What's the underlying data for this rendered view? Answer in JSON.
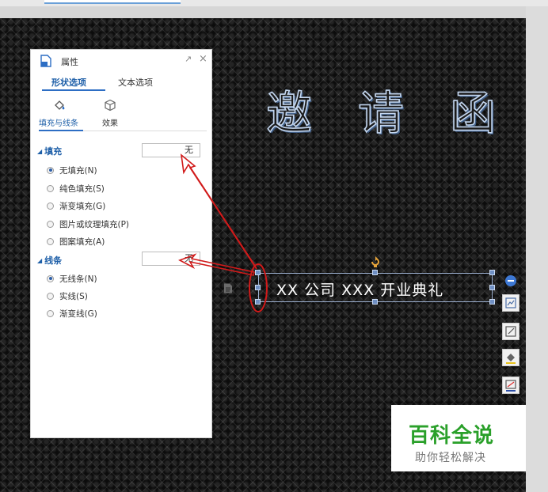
{
  "panel": {
    "title": "属性",
    "pin_icon": "pin-icon",
    "close_icon": "close-icon",
    "tabs": [
      {
        "label": "形状选项",
        "active": true
      },
      {
        "label": "文本选项",
        "active": false
      }
    ],
    "subtabs": [
      {
        "label": "填充与线条",
        "icon": "paint-bucket-icon",
        "active": true
      },
      {
        "label": "效果",
        "icon": "cube-icon",
        "active": false
      }
    ],
    "fill": {
      "heading": "填充",
      "value": "无",
      "options": [
        {
          "label": "无填充(N)",
          "selected": true
        },
        {
          "label": "纯色填充(S)",
          "selected": false
        },
        {
          "label": "渐变填充(G)",
          "selected": false
        },
        {
          "label": "图片或纹理填充(P)",
          "selected": false
        },
        {
          "label": "图案填充(A)",
          "selected": false
        }
      ]
    },
    "line": {
      "heading": "线条",
      "value": "无",
      "options": [
        {
          "label": "无线条(N)",
          "selected": true
        },
        {
          "label": "实线(S)",
          "selected": false
        },
        {
          "label": "渐变线(G)",
          "selected": false
        }
      ]
    }
  },
  "slide": {
    "title_chars": [
      "邀",
      "请",
      "函"
    ],
    "textbox_text": "XX 公司 XXX 开业典礼"
  },
  "toolbar": {
    "buttons": [
      "collapse-icon",
      "layout-icon",
      "crop-icon",
      "fill-icon",
      "outline-icon"
    ]
  },
  "watermark": {
    "title": "百科全说",
    "subtitle": "助你轻松解决"
  },
  "colors": {
    "accent": "#1e5fa8",
    "annotation": "#d11a1a",
    "watermark_green": "#2aa02a",
    "handle": "#6f8fc3"
  }
}
